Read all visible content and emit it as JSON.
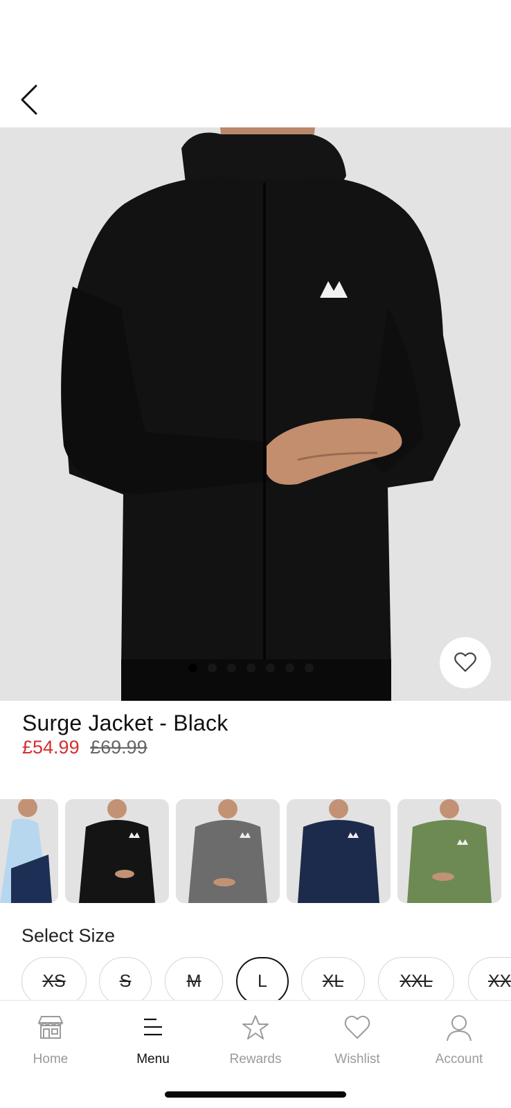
{
  "product": {
    "title": "Surge Jacket - Black",
    "price_sale": "£54.99",
    "price_original": "£69.99",
    "image_count": 7,
    "active_image": 0
  },
  "colors": {
    "accent_sale": "#d32f2f",
    "background": "#ffffff",
    "hero_bg": "#e3e3e3"
  },
  "swatches": [
    {
      "color": "light-blue"
    },
    {
      "color": "black"
    },
    {
      "color": "grey"
    },
    {
      "color": "navy"
    },
    {
      "color": "khaki-green"
    }
  ],
  "size_section": {
    "label": "Select Size",
    "sizes": [
      {
        "label": "XS",
        "available": false,
        "selected": false
      },
      {
        "label": "S",
        "available": false,
        "selected": false
      },
      {
        "label": "M",
        "available": false,
        "selected": false
      },
      {
        "label": "L",
        "available": true,
        "selected": true
      },
      {
        "label": "XL",
        "available": false,
        "selected": false
      },
      {
        "label": "XXL",
        "available": false,
        "selected": false
      },
      {
        "label": "XXXL",
        "available": false,
        "selected": false
      }
    ]
  },
  "tabbar": {
    "items": [
      {
        "label": "Home",
        "icon": "storefront-icon",
        "active": false
      },
      {
        "label": "Menu",
        "icon": "menu-icon",
        "active": true
      },
      {
        "label": "Rewards",
        "icon": "star-icon",
        "active": false
      },
      {
        "label": "Wishlist",
        "icon": "heart-icon",
        "active": false
      },
      {
        "label": "Account",
        "icon": "person-icon",
        "active": false
      }
    ]
  }
}
